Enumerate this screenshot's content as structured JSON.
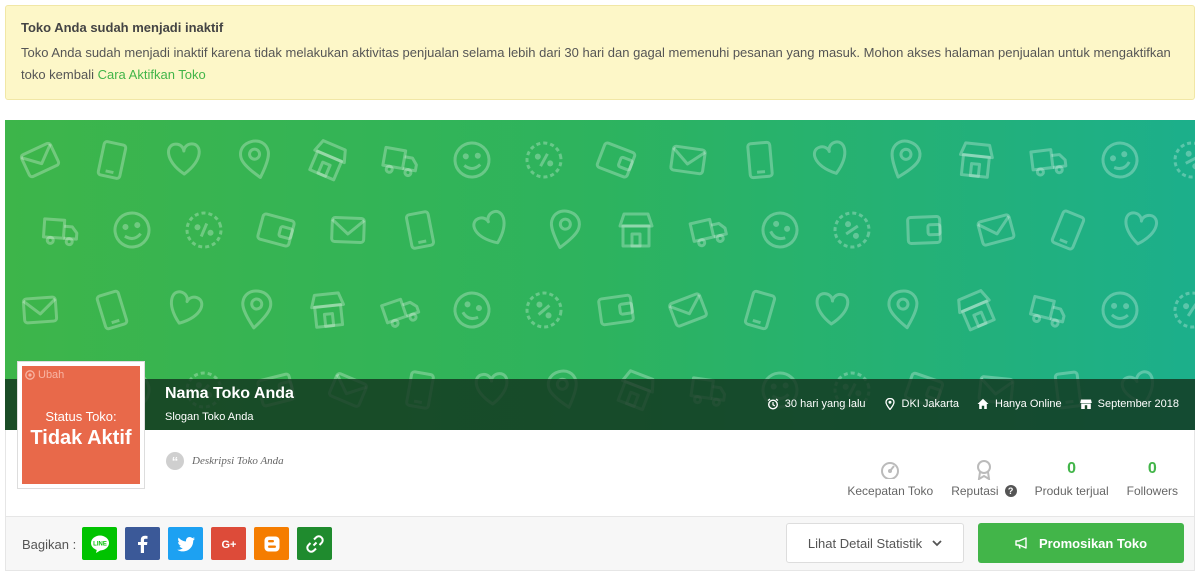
{
  "alert": {
    "title": "Toko Anda sudah menjadi inaktif",
    "message": "Toko Anda sudah menjadi inaktif karena tidak melakukan aktivitas penjualan selama lebih dari 30 hari dan gagal memenuhi pesanan yang masuk. Mohon akses halaman penjualan untuk mengaktifkan toko kembali",
    "link_label": "Cara Aktifkan Toko"
  },
  "shop": {
    "badge": "Ubah",
    "status_label": "Status Toko:",
    "status_value": "Tidak Aktif",
    "name": "Nama Toko Anda",
    "slogan": "Slogan Toko Anda",
    "description": "Deskripsi Toko Anda",
    "meta": {
      "last_online": "30 hari yang lalu",
      "location": "DKI Jakarta",
      "shop_type": "Hanya Online",
      "joined": "September 2018"
    }
  },
  "stats": {
    "speed_label": "Kecepatan Toko",
    "reputation_label": "Reputasi",
    "products_sold_value": "0",
    "products_sold_label": "Produk terjual",
    "followers_value": "0",
    "followers_label": "Followers"
  },
  "footer": {
    "share_label": "Bagikan :",
    "share_buttons": [
      "line",
      "facebook",
      "twitter",
      "google-plus",
      "blogger",
      "copy-link"
    ],
    "detail_button": "Lihat Detail Statistik",
    "promote_button": "Promosikan Toko"
  },
  "colors": {
    "accent": "#42b549",
    "alert_bg": "#fdf7c8",
    "status_inactive": "#e8694a",
    "line": "#00c300",
    "facebook": "#3b5998",
    "twitter": "#1da1f2",
    "google_plus": "#dd4b39",
    "blogger": "#f57d00",
    "copy_link": "#1f8b2e"
  }
}
